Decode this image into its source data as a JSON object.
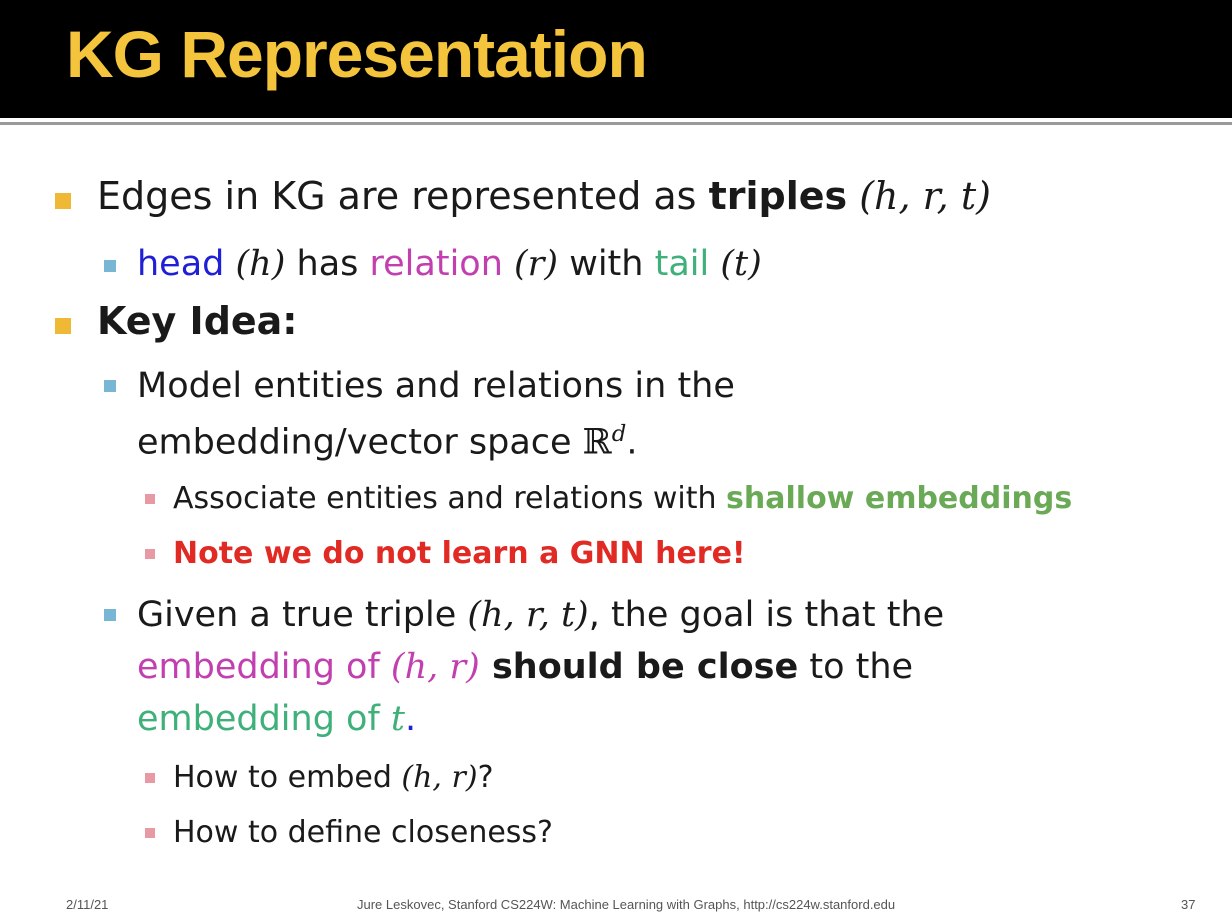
{
  "title": "KG Representation",
  "colors": {
    "title": "#f3c43c",
    "head": "#1f1fd6",
    "relation": "#c23fb0",
    "tail": "#3fb07a",
    "shallow": "#6aaa56",
    "note": "#e02a23",
    "bullet_l1": "#efb935",
    "bullet_l2": "#79b6d4",
    "bullet_l3": "#e89aa4"
  },
  "bullets": {
    "b1": {
      "text": "Edges in KG are represented as ",
      "bold": "triples",
      "math": "(h, r, t)"
    },
    "b1a": {
      "head": "head",
      "head_math": "(h)",
      "has": " has ",
      "relation": "relation",
      "relation_math": "(r)",
      "with": " with ",
      "tail": "tail",
      "tail_math": "(t)"
    },
    "b2": {
      "text": "Key Idea:"
    },
    "b2a": {
      "line1": "Model entities and relations in the",
      "line2": "embedding/vector space ",
      "space_symbol": "ℝ",
      "space_exp": "d",
      "period": "."
    },
    "b2a1": {
      "text": "Associate entities and relations with ",
      "highlight": "shallow embeddings"
    },
    "b2a2": {
      "text": "Note we do not learn a GNN here!"
    },
    "b2b": {
      "line1_a": "Given a true triple ",
      "line1_math": "(h, r, t)",
      "line1_b": ", the goal is that the",
      "line2_a": "embedding of ",
      "line2_math": "(h, r)",
      "line2_bold": " should be close",
      "line2_b": " to the",
      "line3_a": "embedding of ",
      "line3_math": "t",
      "line3_period": "."
    },
    "b2b1": {
      "text": "How to embed ",
      "math": "(h, r)",
      "end": "?"
    },
    "b2b2": {
      "text": "How to define closeness?"
    }
  },
  "footer": {
    "date": "2/11/21",
    "credit": "Jure Leskovec, Stanford CS224W: Machine Learning with Graphs, http://cs224w.stanford.edu",
    "page": "37"
  }
}
